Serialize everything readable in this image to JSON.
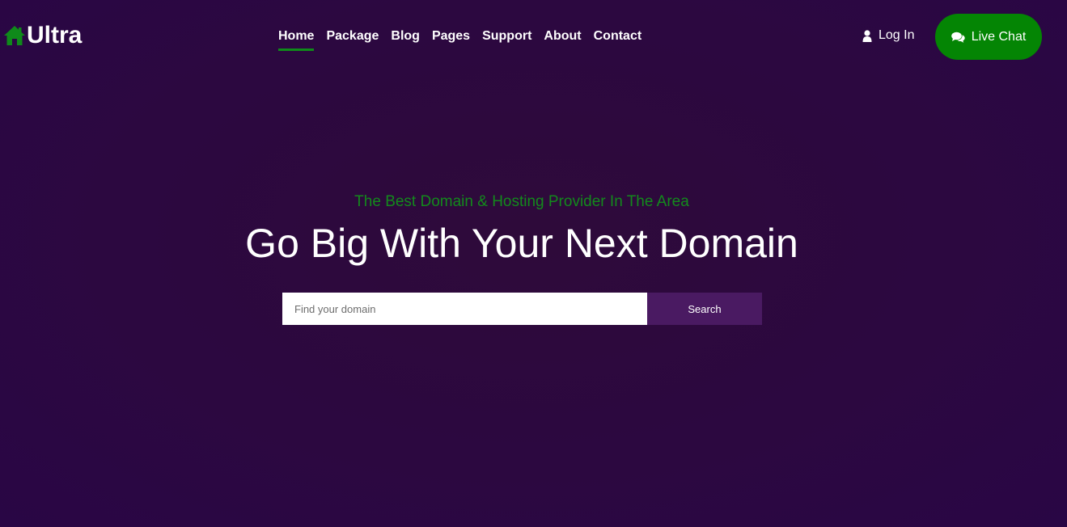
{
  "brand": {
    "name": "Ultra",
    "icon": "home-icon",
    "icon_color": "#0f8a1a"
  },
  "nav": {
    "items": [
      {
        "label": "Home",
        "active": true
      },
      {
        "label": "Package"
      },
      {
        "label": "Blog"
      },
      {
        "label": "Pages"
      },
      {
        "label": "Support"
      },
      {
        "label": "About"
      },
      {
        "label": "Contact"
      }
    ],
    "active_underline_color": "#0f8a1a"
  },
  "header_actions": {
    "login_label": "Log In",
    "login_icon": "user-icon",
    "live_chat_label": "Live Chat",
    "live_chat_icon": "chat-bubbles-icon",
    "live_chat_color": "#048504"
  },
  "hero": {
    "subtitle": "The Best Domain & Hosting Provider In The Area",
    "title": "Go Big With Your Next Domain",
    "subtitle_color": "#138a1c"
  },
  "search": {
    "placeholder": "Find your domain",
    "value": "",
    "button_label": "Search",
    "button_color": "#4a1a62"
  },
  "colors": {
    "background": "#2c0840"
  }
}
